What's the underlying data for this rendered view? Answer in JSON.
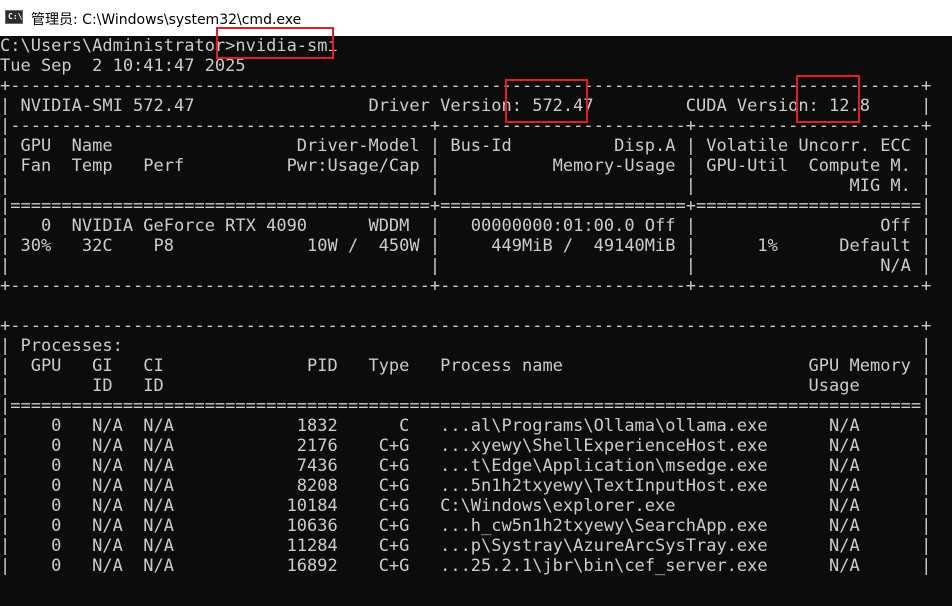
{
  "window": {
    "title": "管理员: C:\\Windows\\system32\\cmd.exe",
    "icon_label": "C:\\",
    "icon": "cmd-console-icon"
  },
  "console": {
    "lines": [
      "C:\\Users\\Administrator>nvidia-smi",
      "Tue Sep  2 10:41:47 2025",
      "+-----------------------------------------------------------------------------------------+",
      "| NVIDIA-SMI 572.47                 Driver Version: 572.47         CUDA Version: 12.8     |",
      "|-----------------------------------------+------------------------+----------------------+",
      "| GPU  Name                  Driver-Model | Bus-Id          Disp.A | Volatile Uncorr. ECC |",
      "| Fan  Temp   Perf          Pwr:Usage/Cap |           Memory-Usage | GPU-Util  Compute M. |",
      "|                                         |                        |               MIG M. |",
      "|=========================================+========================+======================|",
      "|   0  NVIDIA GeForce RTX 4090      WDDM  |   00000000:01:00.0 Off |                  Off |",
      "| 30%   32C    P8             10W /  450W |     449MiB /  49140MiB |      1%      Default |",
      "|                                         |                        |                  N/A |",
      "+-----------------------------------------+------------------------+----------------------+",
      "",
      "+-----------------------------------------------------------------------------------------+",
      "| Processes:                                                                              |",
      "|  GPU   GI   CI              PID   Type   Process name                        GPU Memory |",
      "|        ID   ID                                                               Usage      |",
      "|=========================================================================================|",
      "|    0   N/A  N/A            1832      C   ...al\\Programs\\Ollama\\ollama.exe      N/A      |",
      "|    0   N/A  N/A            2176    C+G   ...xyewy\\ShellExperienceHost.exe      N/A      |",
      "|    0   N/A  N/A            7436    C+G   ...t\\Edge\\Application\\msedge.exe      N/A      |",
      "|    0   N/A  N/A            8208    C+G   ...5n1h2txyewy\\TextInputHost.exe      N/A      |",
      "|    0   N/A  N/A           10184    C+G   C:\\Windows\\explorer.exe               N/A      |",
      "|    0   N/A  N/A           10636    C+G   ...h_cw5n1h2txyewy\\SearchApp.exe      N/A      |",
      "|    0   N/A  N/A           11284    C+G   ...p\\Systray\\AzureArcSysTray.exe      N/A      |",
      "|    0   N/A  N/A           16892    C+G   ...25.2.1\\jbr\\bin\\cef_server.exe      N/A      |"
    ]
  },
  "highlights": {
    "color": "#e02020",
    "items": [
      "nvidia-smi",
      "572.47",
      "12.8"
    ]
  }
}
